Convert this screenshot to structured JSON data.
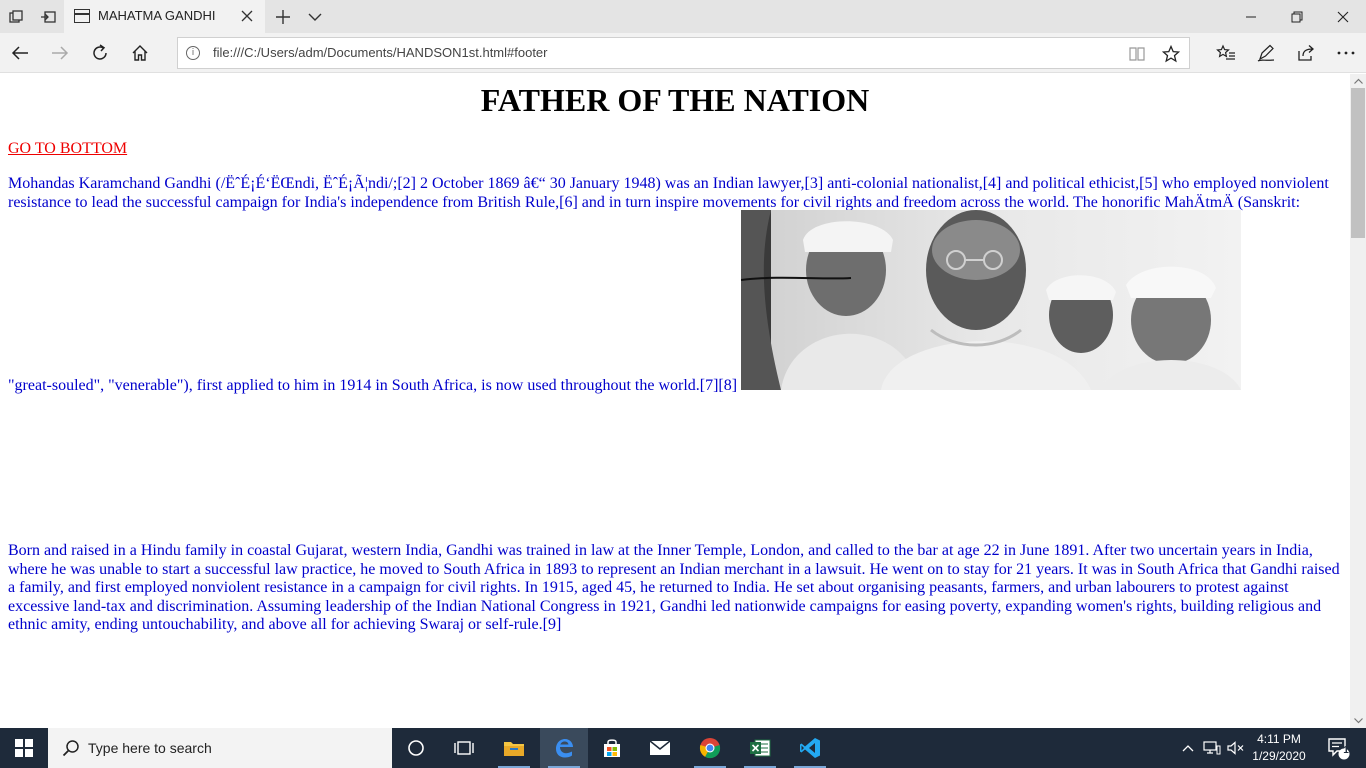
{
  "browser": {
    "tab_title": "MAHATMA GANDHI",
    "address_url": "file:///C:/Users/adm/Documents/HANDSON1st.html#footer"
  },
  "page": {
    "heading": "FATHER OF THE NATION",
    "goto_link": "GO TO BOTTOM",
    "para1_main": "Mohandas Karamchand Gandhi (/ËˆÉ¡É‘ËŒndi, ËˆÉ¡Ã¦ndi/;[2] 2 October 1869 â€“ 30 January 1948) was an Indian lawyer,[3] anti-colonial nationalist,[4] and political ethicist,[5] who employed nonviolent resistance to lead the successful campaign for India's independence from British Rule,[6] and in turn inspire movements for civil rights and freedom across the world. The honorific MahÄtmÄ (Sanskrit:",
    "para1_end": "\"great-souled\", \"venerable\"), first applied to him in 1914 in South Africa, is now used throughout the world.[7][8]",
    "para2": "Born and raised in a Hindu family in coastal Gujarat, western India, Gandhi was trained in law at the Inner Temple, London, and called to the bar at age 22 in June 1891. After two uncertain years in India, where he was unable to start a successful law practice, he moved to South Africa in 1893 to represent an Indian merchant in a lawsuit. He went on to stay for 21 years. It was in South Africa that Gandhi raised a family, and first employed nonviolent resistance in a campaign for civil rights. In 1915, aged 45, he returned to India. He set about organising peasants, farmers, and urban labourers to protest against excessive land-tax and discrimination. Assuming leadership of the Indian National Congress in 1921, Gandhi led nationwide campaigns for easing poverty, expanding women's rights, building religious and ethnic amity, ending untouchability, and above all for achieving Swaraj or self-rule.[9]",
    "link_color": "#ee0000",
    "text_color": "#0000cc"
  },
  "taskbar": {
    "search_placeholder": "Type here to search",
    "time": "4:11 PM",
    "date": "1/29/2020",
    "notification_count": "1",
    "pinned_apps": [
      "cortana-icon",
      "task-view-icon",
      "file-explorer-icon",
      "edge-icon",
      "store-icon",
      "mail-icon",
      "chrome-icon",
      "excel-icon",
      "vscode-icon"
    ]
  }
}
